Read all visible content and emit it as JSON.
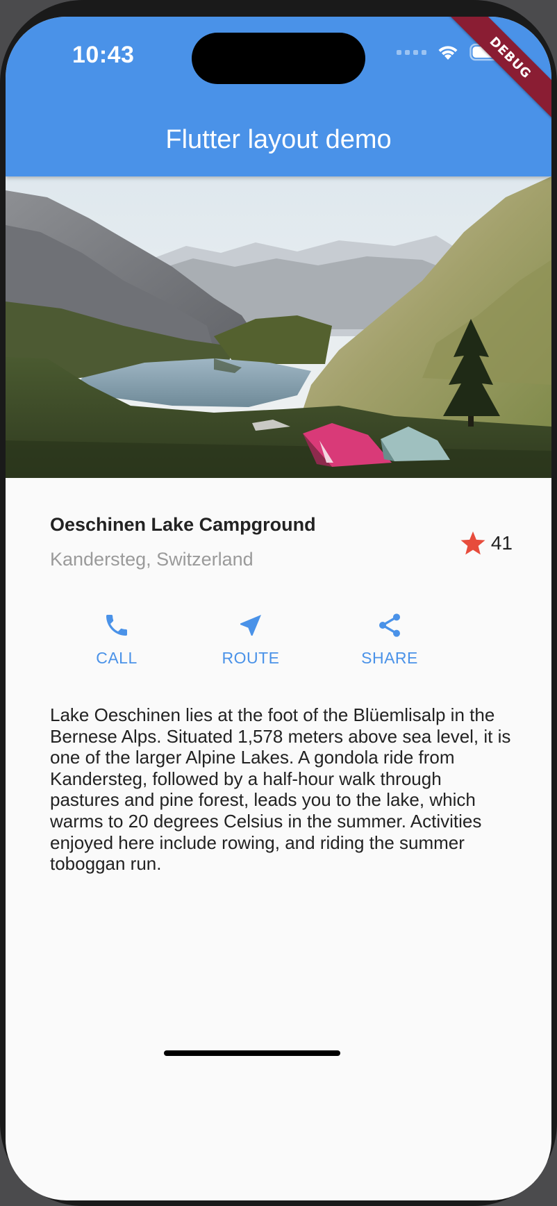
{
  "status_bar": {
    "time": "10:43",
    "icons": [
      "cellular-signal-icon",
      "wifi-icon",
      "battery-icon"
    ]
  },
  "debug_banner": "DEBUG",
  "app_bar": {
    "title": "Flutter layout demo",
    "color": "#4a92e8"
  },
  "hero_image": {
    "subject": "lake-mountain-camp-photo"
  },
  "place": {
    "name": "Oeschinen Lake Campground",
    "location": "Kandersteg, Switzerland",
    "rating_icon": "star-icon",
    "rating_count": "41",
    "star_color": "#e74c3c"
  },
  "actions": [
    {
      "label": "CALL",
      "icon": "phone-icon"
    },
    {
      "label": "ROUTE",
      "icon": "navigation-arrow-icon"
    },
    {
      "label": "SHARE",
      "icon": "share-icon"
    }
  ],
  "accent_color": "#4a92e8",
  "description": "Lake Oeschinen lies at the foot of the Blüemlisalp in the Bernese Alps. Situated 1,578 meters above sea level, it is one of the larger Alpine Lakes. A gondola ride from Kandersteg, followed by a half-hour walk through pastures and pine forest, leads you to the lake, which warms to 20 degrees Celsius in the summer. Activities enjoyed here include rowing, and riding the summer toboggan run."
}
